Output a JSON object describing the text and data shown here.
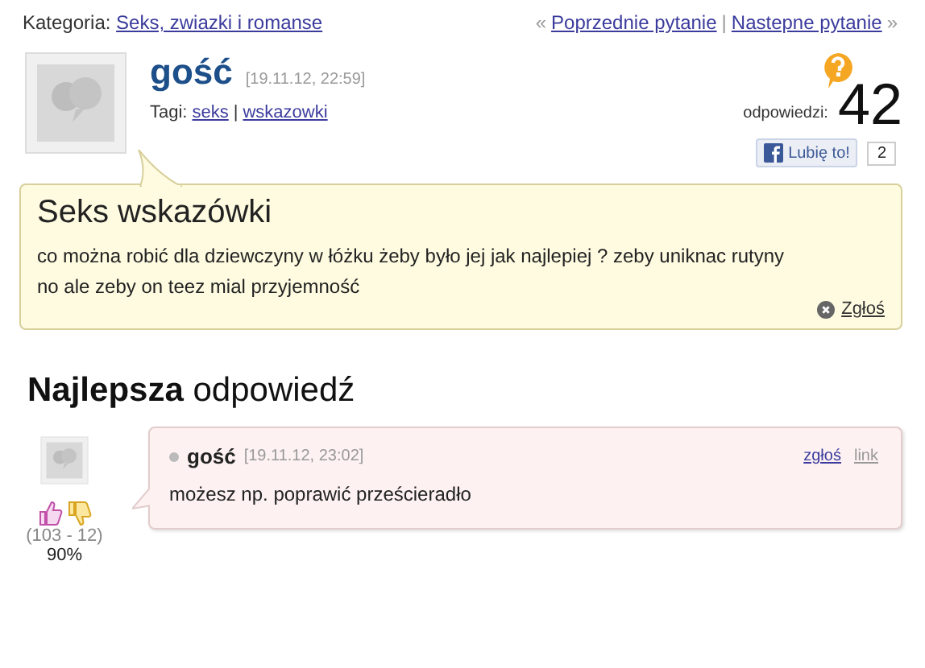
{
  "category": {
    "label": "Kategoria:",
    "link": "Seks, zwiazki i romanse"
  },
  "nav": {
    "prev_mark": "«",
    "prev": "Poprzednie pytanie",
    "separator": "|",
    "next": "Nastepne pytanie",
    "next_mark": "»"
  },
  "question": {
    "author": "gość",
    "date": "[19.11.12, 22:59]",
    "tags_label": "Tagi:",
    "tags": [
      "seks",
      "wskazowki"
    ],
    "tags_separator": "|",
    "answers_label": "odpowiedzi:",
    "answers_count": "42",
    "like_label": "Lubię to!",
    "like_count": "2",
    "title": "Seks wskazówki",
    "body": "co można robić dla dziewczyny w łóżku żeby było jej jak najlepiej ? zeby uniknac rutyny no ale zeby on teez mial przyjemność",
    "report": "Zgłoś"
  },
  "best_answer": {
    "heading": "**Najlepsza** odpowiedź",
    "author": "gość",
    "date": "[19.11.12, 23:02]",
    "report": "zgłoś",
    "link": "link",
    "body": "możesz np. poprawić prześcieradło",
    "votes": "(103 - 12)",
    "percent": "90%"
  }
}
